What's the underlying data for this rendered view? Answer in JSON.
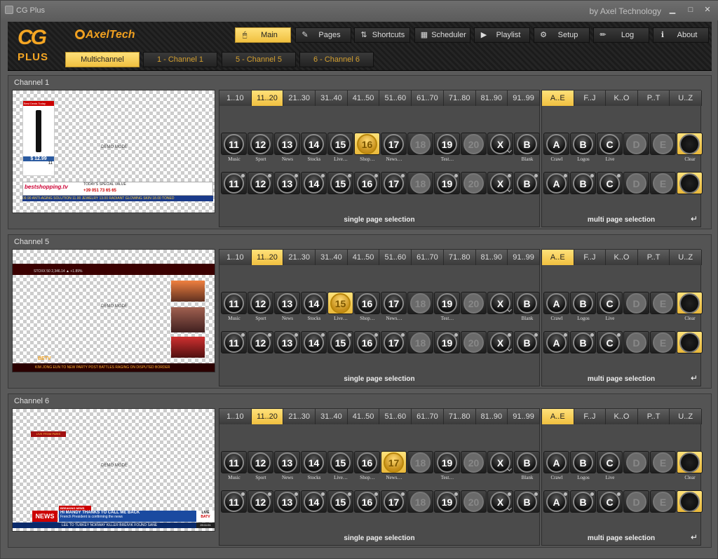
{
  "window": {
    "title": "CG Plus",
    "subtitle": "by Axel Technology",
    "min": "▁",
    "max": "□",
    "close": "✕"
  },
  "logos": {
    "cg": "CG",
    "plus": "PLUS",
    "axel": "AxelTech"
  },
  "nav": [
    {
      "label": "Main",
      "icon": "mouse-icon",
      "active": true
    },
    {
      "label": "Pages",
      "icon": "pencil-icon"
    },
    {
      "label": "Shortcuts",
      "icon": "shortcuts-icon"
    },
    {
      "label": "Scheduler",
      "icon": "scheduler-icon"
    },
    {
      "label": "Playlist",
      "icon": "play-icon"
    },
    {
      "label": "Setup",
      "icon": "gear-icon"
    },
    {
      "label": "Log",
      "icon": "log-icon"
    },
    {
      "label": "About",
      "icon": "info-icon"
    }
  ],
  "channel_tabs": [
    "Multichannel",
    "1 - Channel 1",
    "5 - Channel 5",
    "6 - Channel 6"
  ],
  "range_tabs": [
    "1..10",
    "11..20",
    "21..30",
    "31..40",
    "41..50",
    "51..60",
    "61..70",
    "71..80",
    "81..90",
    "91..99"
  ],
  "multi_tabs": [
    "A..E",
    "F..J",
    "K..O",
    "P..T",
    "U..Z"
  ],
  "single_labels": [
    "Music",
    "Sport",
    "News",
    "Stocks",
    "Live…",
    "Shop…",
    "News…",
    "",
    "Test…",
    "",
    "",
    "Blank"
  ],
  "multi_labels": [
    "Crawl",
    "Logos",
    "Live",
    "",
    "",
    "Clear"
  ],
  "footers": {
    "single": "single page selection",
    "multi": "multi page selection",
    "arrow": "↵"
  },
  "preview_demo": "DEMO MODE",
  "channels": [
    {
      "title": "Channel 1",
      "selected": "16",
      "overlay": {
        "top_bar": "Best Deals Today",
        "price": "$ 12.99",
        "phone": "+39 051 73 65 65",
        "brand": "bestshopping.tv",
        "ticker": "09.90 ANTI-AGING SOLUTION 11.00 JEWELRY 13.00 RADIANT GLOWING SKIN 18.00 TONED",
        "promo": "TODAY'S SPECIAL VALUE",
        "count": "11"
      }
    },
    {
      "title": "Channel 5",
      "selected": "15",
      "overlay": {
        "stock": "STOXX 50  2,346.14 ▲ +1.89%",
        "ticker": "KIM JONG EUN TO NEW PARTY POST   BATTLES RAGING ON DISPUTED BORDER",
        "brand": "BETV"
      }
    },
    {
      "title": "Channel 6",
      "selected": "17",
      "overlay": {
        "tag": "LIVE FROM PARIS",
        "breaking": "BREAKING NEWS",
        "headline": "HI MANDY THANKS TO CALL ME BACK",
        "sub": "French President is confirming the news",
        "ticker": "LEE TO TURKEY   NORWAY KILLER BREIVIK FOUND SANE",
        "live": "LIVE",
        "brand": "BATV",
        "time": "20:11:01",
        "news": "NEWS",
        "updates": "UPDATES"
      }
    }
  ],
  "buttons_row": [
    "11",
    "12",
    "13",
    "14",
    "15",
    "16",
    "17",
    "18",
    "19",
    "20",
    "X",
    "B"
  ],
  "multi_row": [
    "A",
    "B",
    "C",
    "D",
    "E",
    ""
  ]
}
